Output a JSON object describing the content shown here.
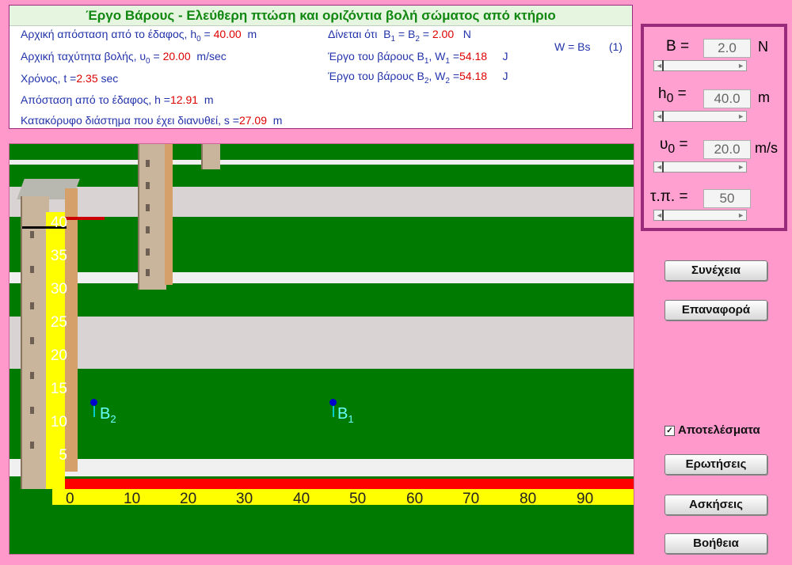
{
  "title": "Έργο Βάρους - Ελεύθερη πτώση και οριζόντια βολή σώματος από κτήριο",
  "info": {
    "h0_label": "Αρχική απόσταση από το έδαφος, h",
    "h0_sub": "0",
    "h0_value": "40.00",
    "h0_unit": "m",
    "u0_label": "Αρχική ταχύτητα βολής, υ",
    "u0_sub": "0",
    "u0_value": "20.00",
    "u0_unit": "m/sec",
    "t_label": "Χρόνος, t =",
    "t_value": "2.35",
    "t_unit": "sec",
    "h_label": "Απόσταση από το έδαφος, h =",
    "h_value": "12.91",
    "h_unit": "m",
    "s_label": "Κατακόρυφο διάστημα που έχει διανυθεί, s =",
    "s_value": "27.09",
    "s_unit": "m",
    "given_label": "Δίνεται ότι",
    "b_value": "2.00",
    "b_unit": "N",
    "w1_label": "Έργο του βάρους Β",
    "w1_value": "54.18",
    "w1_unit": "J",
    "w2_label": "Έργο του βάρους Β",
    "w2_value": "54.18",
    "w2_unit": "J",
    "formula": "W = Bs",
    "formula_num": "(1)"
  },
  "scene": {
    "y_ticks": [
      "40",
      "35",
      "30",
      "25",
      "20",
      "15",
      "10",
      "5"
    ],
    "x_ticks": [
      "0",
      "10",
      "20",
      "30",
      "40",
      "50",
      "60",
      "70",
      "80",
      "90"
    ],
    "b2_label": "B",
    "b2_sub": "2",
    "b1_label": "B",
    "b1_sub": "1"
  },
  "controls": {
    "b_label": "Β =",
    "b_value": "2.0",
    "b_unit": "N",
    "h0_label": "h",
    "h0_sub": "0",
    "h0_eq": "=",
    "h0_value": "40.0",
    "h0_unit": "m",
    "u0_label": "υ",
    "u0_sub": "0",
    "u0_eq": "=",
    "u0_value": "20.0",
    "u0_unit": "m/s",
    "tp_label": "τ.π. =",
    "tp_value": "50"
  },
  "buttons": {
    "continue": "Συνέχεια",
    "reset": "Επαναφορά",
    "questions": "Ερωτήσεις",
    "exercises": "Ασκήσεις",
    "help": "Βοήθεια"
  },
  "results_checkbox": {
    "label": "Αποτελέσματα",
    "checked": true
  },
  "colors": {
    "background": "#ff99cc",
    "panel_border": "#9a2a7a",
    "title_green": "#118811",
    "value_red": "#dd0000",
    "text_blue": "#2233aa"
  }
}
